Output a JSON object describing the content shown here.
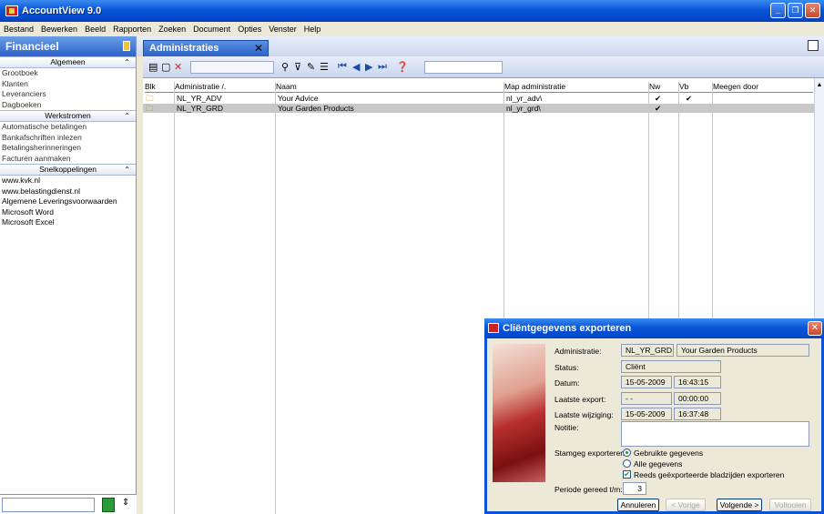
{
  "app": {
    "title": "AccountView 9.0"
  },
  "menu": [
    "Bestand",
    "Bewerken",
    "Beeld",
    "Rapporten",
    "Zoeken",
    "Document",
    "Opties",
    "Venster",
    "Help"
  ],
  "left_panel": {
    "title": "Financieel",
    "sections": [
      {
        "title": "Algemeen",
        "items": [
          "Grootboek",
          "Klanten",
          "Leveranciers",
          "Dagboeken"
        ]
      },
      {
        "title": "Werkstromen",
        "items": [
          "Automatische betalingen",
          "Bankafschriften inlezen",
          "Betalingsherinneringen",
          "Facturen aanmaken"
        ]
      },
      {
        "title": "Snelkoppelingen",
        "items": [
          "www.kvk.nl",
          "www.belastingdienst.nl",
          "Algemene Leveringsvoorwaarden",
          "Microsoft Word",
          "Microsoft Excel"
        ]
      }
    ]
  },
  "tab": {
    "label": "Administraties"
  },
  "grid": {
    "columns": [
      "Blk",
      "Administratie",
      "Naam",
      "Map administratie",
      "Nw",
      "Vb",
      "Meegen door"
    ],
    "sort_indicator": "/.",
    "rows": [
      {
        "administratie": "NL_YR_ADV",
        "naam": "Your Advice",
        "map": "nl_yr_adv\\",
        "nw": "✔",
        "vb": "✔",
        "selected": false
      },
      {
        "administratie": "NL_YR_GRD",
        "naam": "Your Garden Products",
        "map": "nl_yr_grd\\",
        "nw": "✔",
        "vb": "",
        "selected": true
      }
    ]
  },
  "dialog": {
    "title": "Cliëntgegevens exporteren",
    "labels": {
      "administratie": "Administratie:",
      "status": "Status:",
      "datum": "Datum:",
      "laatste_export": "Laatste export:",
      "laatste_wijziging": "Laatste wijziging:",
      "notitie": "Notitie:",
      "stamgeg": "Stamgeg exporteren:",
      "periode": "Periode gereed t/m:"
    },
    "values": {
      "administratie_code": "NL_YR_GRD",
      "administratie_naam": "Your Garden Products",
      "status": "Cliënt",
      "datum": "15-05-2009",
      "datum_tijd": "16:43:15",
      "laatste_export": "- -",
      "laatste_export_tijd": "00:00:00",
      "laatste_wijziging": "15-05-2009",
      "laatste_wijziging_tijd": "16:37:48",
      "notitie": "",
      "periode": "3"
    },
    "options": {
      "gebruikte": "Gebruikte gegevens",
      "alle": "Alle gegevens",
      "reeds": "Reeds geëxporteerde bladzijden exporteren"
    },
    "buttons": {
      "annuleren": "Annuleren",
      "vorige": "< Vorige",
      "volgende": "Volgende >",
      "voltooien": "Voltooien"
    }
  }
}
